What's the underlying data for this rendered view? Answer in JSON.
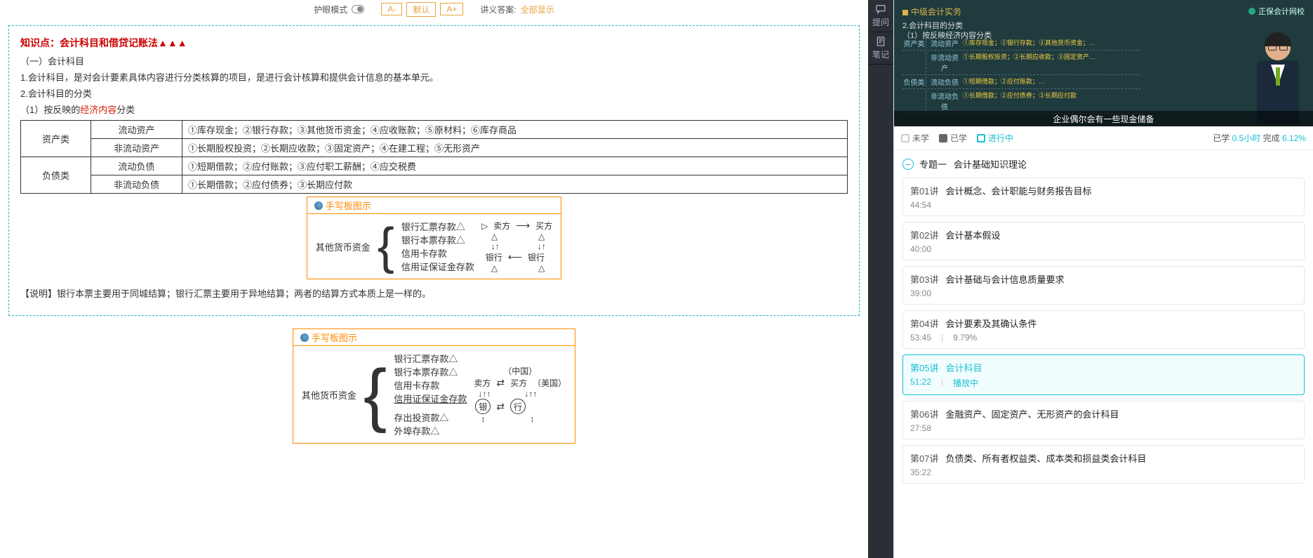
{
  "toolbar": {
    "eye_mode": "护眼模式",
    "a_minus": "A-",
    "a_default": "默认",
    "a_plus": "A+",
    "answers_label": "讲义答案:",
    "answers_value": "全部显示"
  },
  "side_tabs": {
    "ask": "提问",
    "note": "笔记"
  },
  "lecture": {
    "kp_title": "知识点：会计科目和借贷记账法▲▲▲",
    "s1": "（一）会计科目",
    "s1_1": "1.会计科目，是对会计要素具体内容进行分类核算的项目，是进行会计核算和提供会计信息的基本单元。",
    "s1_2": "2.会计科目的分类",
    "s1_3a": "（1）按反映的",
    "s1_3b": "经济内容",
    "s1_3c": "分类",
    "table": {
      "r1": {
        "cat": "资产类",
        "sub1": "流动资产",
        "val1": "①库存现金；②银行存款；③其他货币资金；④应收账款；⑤原材料；⑥库存商品",
        "sub2": "非流动资产",
        "val2": "①长期股权投资；②长期应收款；③固定资产；④在建工程；⑤无形资产"
      },
      "r2": {
        "cat": "负债类",
        "sub1": "流动负债",
        "val1": "①短期借款；②应付账款；③应付职工薪酬；④应交税费",
        "sub2": "非流动负债",
        "val2": "①长期借款；②应付债券；③长期应付款"
      }
    },
    "sketch_label": "手写板图示",
    "sketch1_left": "其他货币资金",
    "sketch1_items": {
      "a": "银行汇票存款△",
      "b": "银行本票存款△",
      "c": "信用卡存款",
      "d": "信用证保证金存款"
    },
    "diag1": {
      "sell": "卖方",
      "buy": "买方",
      "bank": "银行",
      "tri": "△"
    },
    "note": "【说明】银行本票主要用于同城结算；银行汇票主要用于异地结算；两者的结算方式本质上是一样的。",
    "sketch2_left": "其他货币资金",
    "sketch2_items": {
      "a": "银行汇票存款△",
      "b": "银行本票存款△",
      "c": "信用卡存款",
      "d": "信用证保证金存款",
      "e": "存出投资款△",
      "f": "外埠存款△"
    },
    "diag2": {
      "cn": "（中国）",
      "us": "（美国）",
      "sell": "卖方",
      "buy": "买方",
      "bank1": "银",
      "bank2": "行"
    }
  },
  "video": {
    "course": "中级会计实务",
    "brand": "正保会计网校",
    "l1": "2.会计科目的分类",
    "l2": "（1）按反映经济内容分类",
    "board": [
      {
        "c1": "资产类",
        "c2": "流动资产",
        "c3": "①库存现金；②银行存款；③其他货币资金；…"
      },
      {
        "c1": "",
        "c2": "非流动资产",
        "c3": "①长期股权投资；②长期应收款；③固定资产…"
      },
      {
        "c1": "负债类",
        "c2": "流动负债",
        "c3": "①短期借款；②应付账款；…"
      },
      {
        "c1": "",
        "c2": "非流动负债",
        "c3": "①长期借款；②应付债券；③长期应付款"
      }
    ],
    "subtitle": "企业偶尔会有一些现金储备"
  },
  "status": {
    "not": "未学",
    "done": "已学",
    "ing": "进行中",
    "right_a": "已学",
    "right_b": "0.5小时",
    "right_c": "完成",
    "right_d": "6.12%"
  },
  "topic": {
    "pre": "专题一",
    "title": "会计基础知识理论"
  },
  "lessons": [
    {
      "num": "第01讲",
      "title": "会计概念、会计职能与财务报告目标",
      "time": "44:54",
      "pct": "",
      "extra": ""
    },
    {
      "num": "第02讲",
      "title": "会计基本假设",
      "time": "40:00",
      "pct": "",
      "extra": ""
    },
    {
      "num": "第03讲",
      "title": "会计基础与会计信息质量要求",
      "time": "39:00",
      "pct": "",
      "extra": ""
    },
    {
      "num": "第04讲",
      "title": "会计要素及其确认条件",
      "time": "53:45",
      "pct": "9.79%",
      "extra": ""
    },
    {
      "num": "第05讲",
      "title": "会计科目",
      "time": "51:22",
      "pct": "",
      "extra": "播放中"
    },
    {
      "num": "第06讲",
      "title": "金融资产、固定资产、无形资产的会计科目",
      "time": "27:58",
      "pct": "",
      "extra": ""
    },
    {
      "num": "第07讲",
      "title": "负债类、所有者权益类、成本类和损益类会计科目",
      "time": "35:22",
      "pct": "",
      "extra": ""
    }
  ]
}
